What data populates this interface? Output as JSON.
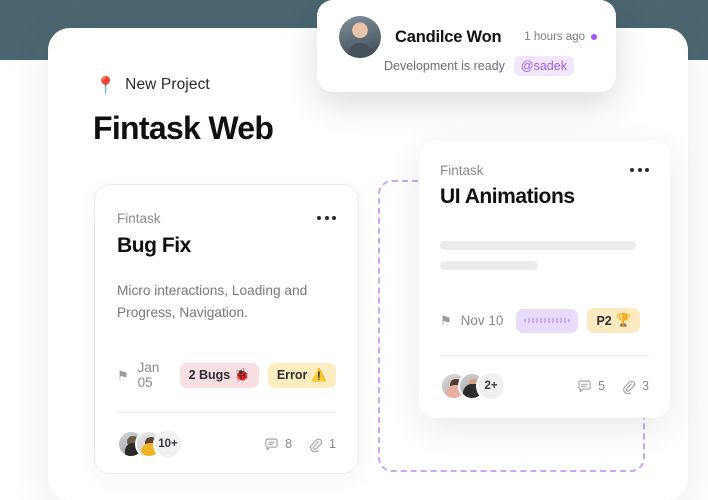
{
  "header": {
    "project_badge_icon": "pin-emoji",
    "project_badge_emoji": "📍",
    "project_label": "New Project",
    "title": "Fintask Web"
  },
  "notification": {
    "avatar_icon": "user-avatar",
    "name": "Candilce Won",
    "time": "1 hours ago",
    "status_dot_color": "#a855f7",
    "message": "Development  is ready",
    "mention": "@sadek"
  },
  "dropzone": {
    "border_color": "#c9a7f2"
  },
  "cards": [
    {
      "id": "bug-fix",
      "subtitle": "Fintask",
      "title": "Bug Fix",
      "description": "Micro interactions, Loading and Progress, Navigation.",
      "menu_icon": "more-options-icon",
      "flag_icon": "flag-icon",
      "flag_glyph": "⚑",
      "date": "Jan 05",
      "chips": [
        {
          "label": "2 Bugs",
          "emoji": "🐞",
          "bg": "#fadfe2"
        },
        {
          "label": "Error",
          "emoji": "⚠️",
          "bg": "#fdeec2"
        }
      ],
      "avatars_more": "10+",
      "comments_icon": "comment-icon",
      "comments": "8",
      "attachments_icon": "attachment-icon",
      "attachments": "1"
    },
    {
      "id": "ui-animations",
      "subtitle": "Fintask",
      "title": "UI Animations",
      "menu_icon": "more-options-icon",
      "flag_icon": "flag-icon",
      "flag_glyph": "⚑",
      "date": "Nov 10",
      "chips": [
        {
          "label": "",
          "emoji": "",
          "bg": "#e9dcfb"
        },
        {
          "label": "P2",
          "emoji": "🏆",
          "bg": "#fdeac1"
        }
      ],
      "avatars_more": "2+",
      "comments_icon": "comment-icon",
      "comments": "5",
      "attachments_icon": "attachment-icon",
      "attachments": "3"
    }
  ],
  "theme": {
    "backdrop": "#4b6670",
    "panel": "#ffffff",
    "accent_purple": "#9b5cf0"
  }
}
